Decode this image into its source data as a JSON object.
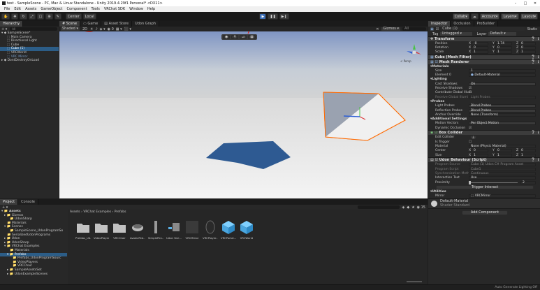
{
  "window": {
    "title": "test - SampleScene - PC, Mac & Linux Standalone - Unity 2019.4.29f1 Personal* <DX11>"
  },
  "menu": [
    "File",
    "Edit",
    "Assets",
    "GameObject",
    "Component",
    "Tools",
    "VRChat SDK",
    "Window",
    "Help"
  ],
  "toolbar": {
    "pivot_label": "Center",
    "space_label": "Local",
    "collab_label": "Collab",
    "account_label": "Account",
    "layers_label": "Layers",
    "layout_label": "Layout"
  },
  "hierarchy": {
    "tab_label": "Hierarchy",
    "search_placeholder": "All",
    "items": [
      {
        "label": "SampleScene*"
      },
      {
        "label": "Main Camera"
      },
      {
        "label": "Directional Light"
      },
      {
        "label": "Cube"
      },
      {
        "label": "Cube (1)"
      },
      {
        "label": "VRCWorld"
      },
      {
        "label": "VRC Mirror"
      },
      {
        "label": "DontDestroyOnLoad"
      }
    ]
  },
  "scene": {
    "tabs": [
      {
        "label": "Scene"
      },
      {
        "label": "Game"
      },
      {
        "label": "Asset Store"
      },
      {
        "label": "Udon Graph"
      }
    ],
    "shading_mode": "Shaded",
    "twod_label": "2D",
    "gizmos_label": "Gizmos",
    "search_placeholder": "All",
    "persp_label": "< Persp"
  },
  "inspector": {
    "tabs": [
      {
        "label": "Inspector"
      },
      {
        "label": "Occlusion"
      },
      {
        "label": "ProBuilder"
      }
    ],
    "object_name": "Cube (1)",
    "static_label": "Static",
    "tag_label": "Tag",
    "tag_value": "Untagged",
    "layer_label": "Layer",
    "layer_value": "Default",
    "transform": {
      "title": "Transform",
      "position": {
        "label": "Position",
        "x": "-0",
        "y": "1.74",
        "z": "0"
      },
      "rotation": {
        "label": "Rotation",
        "x": "0",
        "y": "0",
        "z": "0"
      },
      "scale": {
        "label": "Scale",
        "x": "1",
        "y": "1",
        "z": "1"
      }
    },
    "mesh_filter": {
      "title": "Cube (Mesh Filter)"
    },
    "mesh_renderer": {
      "title": "Mesh Renderer",
      "materials_label": "Materials",
      "size_label": "Size",
      "size_value": "1",
      "element_label": "Element 0",
      "element_value": "Default-Material",
      "lighting_label": "Lighting",
      "cast_shadows_label": "Cast Shadows",
      "cast_shadows_value": "On",
      "receive_shadows_label": "Receive Shadows",
      "contribute_gi_label": "Contribute Global Illum",
      "receive_gi_label": "Receive Global Illumi",
      "receive_gi_value": "Light Probes",
      "probes_label": "Probes",
      "light_probes_label": "Light Probes",
      "light_probes_value": "Blend Probes",
      "reflection_probes_label": "Reflection Probes",
      "reflection_probes_value": "Blend Probes",
      "anchor_override_label": "Anchor Override",
      "anchor_override_value": "None (Transform)",
      "additional_label": "Additional Settings",
      "motion_vectors_label": "Motion Vectors",
      "motion_vectors_value": "Per Object Motion",
      "dynamic_occlusion_label": "Dynamic Occlusion"
    },
    "box_collider": {
      "title": "Box Collider",
      "edit_label": "Edit Collider",
      "is_trigger_label": "Is Trigger",
      "material_label": "Material",
      "material_value": "None (Physic Material)",
      "center": {
        "label": "Center",
        "x": "0",
        "y": "0",
        "z": "0"
      },
      "size": {
        "label": "Size",
        "x": "1",
        "y": "1",
        "z": "1"
      }
    },
    "udon": {
      "title": "Udon Behaviour (Script)",
      "program_source_label": "Program Source",
      "program_source_value": "Cube (1) Udon C# Program Asset",
      "program_script_label": "Program Script",
      "program_script_value": "Cube1",
      "sync_label": "Synchronization Method",
      "sync_value": "Continuous",
      "interaction_text_label": "Interaction Text",
      "interaction_text_value": "Use",
      "proximity_label": "Proximity",
      "proximity_value": "2",
      "trigger_button": "Trigger Interact",
      "utilities_label": "Utilities",
      "mirror_label": "Mirror",
      "mirror_value": "VRCMirror"
    },
    "material": {
      "name": "Default-Material",
      "shader_label": "Shader",
      "shader_value": "Standard"
    },
    "add_component": "Add Component"
  },
  "project": {
    "tabs": [
      {
        "label": "Project"
      },
      {
        "label": "Console"
      }
    ],
    "assets_root": "Assets",
    "tree": [
      {
        "label": "Assets"
      },
      {
        "label": "Gizmos"
      },
      {
        "label": "UdonSharp"
      },
      {
        "label": "Materials"
      },
      {
        "label": "Scenes"
      },
      {
        "label": "SampleScene_UdonProgramSo"
      },
      {
        "label": "SerializedUdonPrograms"
      },
      {
        "label": "Udon"
      },
      {
        "label": "UdonSharp"
      },
      {
        "label": "VRChat Examples"
      },
      {
        "label": "Materials"
      },
      {
        "label": "Prefabs"
      },
      {
        "label": "Prefabs_UdonProgramSourc"
      },
      {
        "label": "VideoPlayers"
      },
      {
        "label": "VRCChair"
      },
      {
        "label": "SampleAssetsSet"
      },
      {
        "label": "UdonExampleScenes"
      }
    ],
    "breadcrumb": [
      "Assets",
      "VRChat Examples",
      "Prefabs"
    ],
    "count_label": "15",
    "assets": [
      {
        "name": "Prefabs_Ud..."
      },
      {
        "name": "VideoPlayers"
      },
      {
        "name": "VRCChair"
      },
      {
        "name": "AvatarPed..."
      },
      {
        "name": "SimplePen..."
      },
      {
        "name": "Udon Vari..."
      },
      {
        "name": "VRCMirror"
      },
      {
        "name": "VRCPlayer..."
      },
      {
        "name": "VRCPortal..."
      },
      {
        "name": "VRCWorld"
      }
    ]
  },
  "status": {
    "text": "Auto Generate Lighting Off"
  }
}
